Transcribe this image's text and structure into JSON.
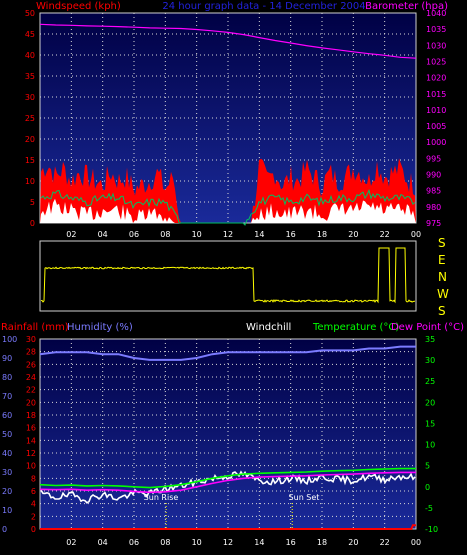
{
  "top_header": {
    "left_label": "Windspeed (kph)",
    "center_label": "24 hour graph data - 14 December 2004",
    "right_label": "Barometer (hpa)"
  },
  "bottom_header": {
    "rainfall_label": "Rainfall (mm)",
    "humidity_label": "Humidity (%)",
    "windchill_label": "Windchill",
    "temperature_label": "Temperature (°C)",
    "dewpoint_label": "Dew Point (°C)"
  },
  "compass_letters": [
    "S",
    "E",
    "N",
    "W",
    "S"
  ],
  "x_ticks": [
    "02",
    "04",
    "06",
    "08",
    "10",
    "12",
    "14",
    "16",
    "18",
    "20",
    "22",
    "00"
  ],
  "annotations": {
    "sun_rise": "Sun Rise",
    "sun_set": "Sun Set"
  },
  "colors": {
    "plot_bg_top": "#000044",
    "plot_bg_bottom": "#1a2a9a",
    "windspeed": "#ff0000",
    "wind_avg": "#00c060",
    "wind_gust_fill": "#ffffff",
    "barometer": "#ff00ff",
    "direction": "#ffff00",
    "humidity": "#7b7bff",
    "temperature": "#00ff00",
    "dew_point": "#ff00ff",
    "windchill": "#ffffff",
    "rainfall": "#ff0000"
  },
  "chart_data": [
    {
      "type": "line",
      "name": "windspeed-barometer",
      "x_unit": "hour",
      "xlim": [
        0,
        24
      ],
      "ylim_left": [
        0,
        50
      ],
      "ylim_right": [
        975,
        1040
      ],
      "left_ticks": [
        0,
        5,
        10,
        15,
        20,
        25,
        30,
        35,
        40,
        45,
        50
      ],
      "right_ticks": [
        975,
        980,
        985,
        990,
        995,
        1000,
        1005,
        1010,
        1015,
        1020,
        1025,
        1030,
        1035,
        1040
      ],
      "grid": true,
      "series": [
        {
          "name": "Barometer (hpa)",
          "axis": "right",
          "x": [
            0,
            1,
            2,
            3,
            4,
            5,
            6,
            7,
            8,
            9,
            10,
            11,
            12,
            13,
            14,
            15,
            16,
            17,
            18,
            19,
            20,
            21,
            22,
            23,
            24
          ],
          "values": [
            1036.5,
            1036.3,
            1036.2,
            1036.0,
            1035.9,
            1035.8,
            1035.6,
            1035.4,
            1035.3,
            1035.2,
            1034.9,
            1034.5,
            1034.0,
            1033.3,
            1032.4,
            1031.5,
            1030.7,
            1029.9,
            1029.2,
            1028.6,
            1028.0,
            1027.4,
            1026.9,
            1026.3,
            1026.0
          ]
        },
        {
          "name": "Windspeed (kph)",
          "axis": "left",
          "x": [
            0,
            0.5,
            1,
            1.5,
            2,
            2.5,
            3,
            3.5,
            4,
            4.5,
            5,
            5.5,
            6,
            6.5,
            7,
            7.5,
            8,
            8.5,
            9,
            9.5,
            10,
            10.5,
            11,
            11.5,
            12,
            12.5,
            13,
            13.5,
            14,
            14.5,
            15,
            15.5,
            16,
            16.5,
            17,
            17.5,
            18,
            18.5,
            19,
            19.5,
            20,
            20.5,
            21,
            21.5,
            22,
            22.5,
            23,
            23.5,
            24
          ],
          "values": [
            12,
            14,
            11,
            13,
            10,
            12,
            11,
            10,
            9,
            12,
            10,
            11,
            8,
            9,
            10,
            12,
            8,
            11,
            0,
            0,
            0,
            0,
            0,
            0,
            0,
            0,
            0,
            0,
            14,
            10,
            12,
            9,
            11,
            10,
            13,
            11,
            9,
            12,
            10,
            11,
            13,
            12,
            10,
            14,
            11,
            12,
            13,
            10,
            9
          ]
        },
        {
          "name": "Wind average",
          "axis": "left",
          "x": [
            0,
            1,
            2,
            3,
            4,
            5,
            6,
            7,
            8,
            9,
            10,
            11,
            12,
            13,
            14,
            15,
            16,
            17,
            18,
            19,
            20,
            21,
            22,
            23,
            24
          ],
          "values": [
            6,
            7,
            6,
            5,
            6,
            6,
            4,
            5,
            5,
            0,
            0,
            0,
            0,
            0,
            5,
            6,
            5,
            6,
            5,
            6,
            6,
            7,
            6,
            6,
            5
          ]
        }
      ]
    },
    {
      "type": "line",
      "name": "wind-direction",
      "x_unit": "hour",
      "xlim": [
        0,
        24
      ],
      "x": [
        0,
        0.3,
        1,
        2,
        3,
        4,
        4.5,
        5,
        6,
        7,
        8,
        9,
        10,
        11,
        12,
        13,
        13.5,
        13.6,
        14,
        15,
        16,
        17,
        18,
        19,
        19.5,
        20,
        21,
        21.5,
        21.6,
        22.2,
        22.3,
        22.6,
        22.7,
        23.2,
        23.3,
        24
      ],
      "values": [
        "S",
        "W",
        "W",
        "W",
        "W",
        "W",
        "W",
        "W",
        "W",
        "W",
        "W",
        "W",
        "W",
        "W",
        "W",
        "W",
        "W",
        "S",
        "S",
        "S",
        "S",
        "S",
        "S",
        "S",
        "S",
        "S",
        "S",
        "S",
        "E",
        "E",
        "S",
        "S",
        "E",
        "E",
        "S",
        "S"
      ]
    },
    {
      "type": "line",
      "name": "temperature-humidity-rainfall",
      "x_unit": "hour",
      "xlim": [
        0,
        24
      ],
      "ylim_left": [
        0,
        30
      ],
      "ylim_humidity": [
        0,
        100
      ],
      "ylim_right": [
        -10,
        35
      ],
      "left_ticks": [
        0,
        2,
        4,
        6,
        8,
        10,
        12,
        14,
        16,
        18,
        20,
        22,
        24,
        26,
        28,
        30
      ],
      "humidity_ticks": [
        0,
        10,
        20,
        30,
        40,
        50,
        60,
        70,
        80,
        90,
        100
      ],
      "right_ticks": [
        -10,
        -5,
        0,
        5,
        10,
        15,
        20,
        25,
        30,
        35
      ],
      "grid": true,
      "series": [
        {
          "name": "Humidity (%)",
          "axis": "humidity",
          "x": [
            0,
            1,
            2,
            3,
            4,
            5,
            6,
            7,
            8,
            9,
            10,
            11,
            12,
            13,
            14,
            15,
            16,
            17,
            18,
            19,
            20,
            21,
            22,
            23,
            24
          ],
          "values": [
            92,
            93,
            93,
            93,
            92,
            92,
            90,
            89,
            89,
            89,
            90,
            92,
            93,
            93,
            93,
            93,
            93,
            93,
            94,
            94,
            94,
            95,
            95,
            96,
            96
          ]
        },
        {
          "name": "Temperature (°C)",
          "axis": "right",
          "x": [
            0,
            1,
            2,
            3,
            4,
            5,
            6,
            7,
            8,
            9,
            10,
            11,
            12,
            13,
            14,
            15,
            16,
            17,
            18,
            19,
            20,
            21,
            22,
            23,
            24
          ],
          "values": [
            0.5,
            0.3,
            0.4,
            0.2,
            0.3,
            0.2,
            0,
            -0.2,
            0.1,
            0.5,
            1.2,
            2,
            2.6,
            3,
            3.2,
            3.3,
            3.4,
            3.5,
            3.7,
            3.8,
            3.9,
            4.1,
            4.2,
            4.3,
            4.3
          ]
        },
        {
          "name": "Dew Point (°C)",
          "axis": "right",
          "x": [
            0,
            1,
            2,
            3,
            4,
            5,
            6,
            7,
            8,
            9,
            10,
            11,
            12,
            13,
            14,
            15,
            16,
            17,
            18,
            19,
            20,
            21,
            22,
            23,
            24
          ],
          "values": [
            -0.6,
            -0.7,
            -0.6,
            -0.8,
            -0.7,
            -0.8,
            -1.1,
            -1.3,
            -1.2,
            -0.8,
            0,
            0.8,
            1.5,
            2,
            2.3,
            2.4,
            2.5,
            2.6,
            2.8,
            2.9,
            3.0,
            3.2,
            3.3,
            3.4,
            3.4
          ]
        },
        {
          "name": "Windchill",
          "axis": "right",
          "x": [
            0,
            1,
            2,
            3,
            4,
            5,
            6,
            7,
            8,
            9,
            10,
            11,
            12,
            13,
            14,
            15,
            16,
            17,
            18,
            19,
            20,
            21,
            22,
            23,
            24
          ],
          "values": [
            -1.5,
            -2.5,
            -2,
            -3,
            -1.8,
            -2.8,
            -1.5,
            -1.6,
            -0.5,
            0.2,
            1.1,
            2,
            2.6,
            3,
            1.5,
            1.2,
            2,
            1.4,
            2.3,
            1.8,
            1.5,
            2.4,
            1.8,
            2.5,
            2.2
          ]
        },
        {
          "name": "Rainfall (mm)",
          "axis": "left",
          "x": [
            0,
            23.7,
            23.8,
            24
          ],
          "values": [
            0,
            0,
            0.6,
            0.6
          ]
        }
      ],
      "markers": [
        {
          "label": "Sun Rise",
          "x": 8.05
        },
        {
          "label": "Sun Set",
          "x": 16.1
        }
      ]
    }
  ]
}
